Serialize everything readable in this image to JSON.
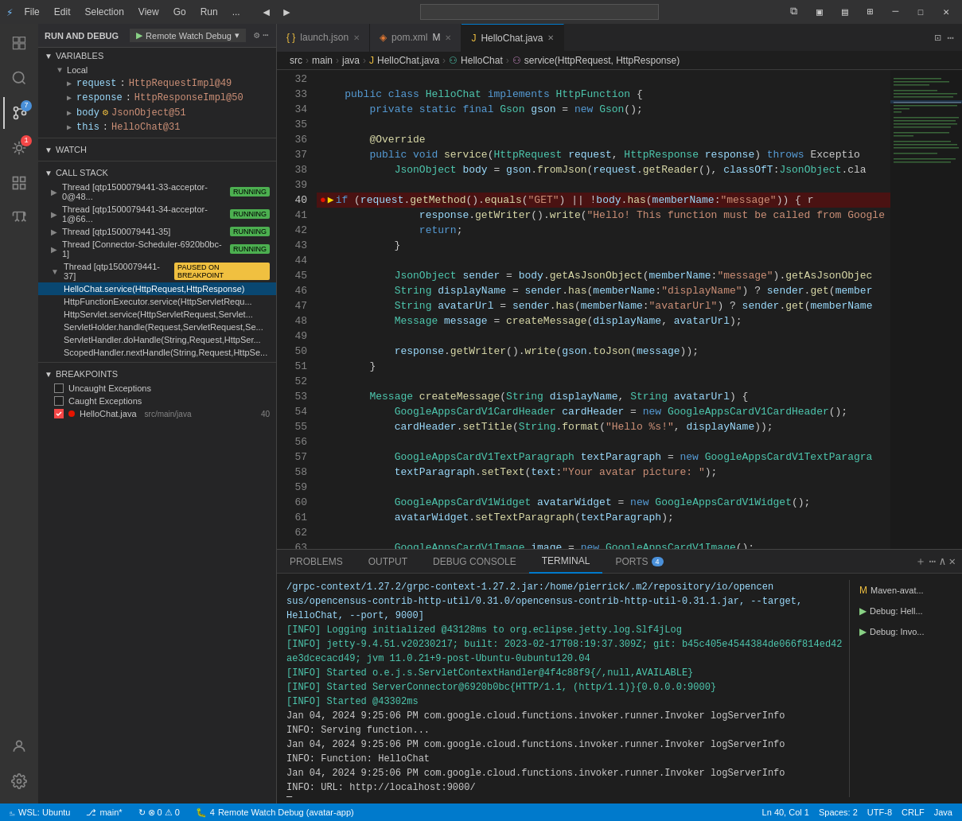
{
  "titlebar": {
    "icon": "⚡",
    "menus": [
      "File",
      "Edit",
      "Selection",
      "View",
      "Go",
      "Run",
      "..."
    ],
    "nav_back": "◄",
    "nav_forward": "►",
    "controls": {
      "minimize": "─",
      "restore": "☐",
      "close": "✕"
    }
  },
  "debug_toolbar": {
    "title": "RUN AND DEBUG",
    "config_label": "Remote Watch Debug",
    "play_icon": "▶",
    "actions": [
      "▶",
      "↺",
      "⟳",
      "⬇",
      "⬆",
      "↩",
      "⏹",
      "🔴",
      "⚡"
    ]
  },
  "tabs": [
    {
      "id": "launch_json",
      "label": "launch.json",
      "icon": "{ }",
      "active": false,
      "modified": false
    },
    {
      "id": "pom_xml",
      "label": "pom.xml",
      "icon": "◈",
      "active": false,
      "modified": true
    },
    {
      "id": "hello_chat",
      "label": "HelloChat.java",
      "icon": "J",
      "active": true,
      "modified": false
    }
  ],
  "breadcrumb": {
    "parts": [
      "src",
      "main",
      "java",
      "HelloChat.java",
      "HelloChat",
      "service(HttpRequest, HttpResponse)"
    ],
    "separators": [
      ">",
      ">",
      ">",
      ">",
      ">"
    ]
  },
  "variables": {
    "section_title": "VARIABLES",
    "subsections": [
      {
        "title": "Local",
        "items": [
          {
            "name": "request",
            "value": "HttpRequestImpl@49",
            "expanded": false
          },
          {
            "name": "response",
            "value": "HttpResponseImpl@50",
            "expanded": false
          },
          {
            "name": "body",
            "type_icon": "⚙",
            "value": "JsonObject@51",
            "expanded": false
          },
          {
            "name": "this",
            "value": "HelloChat@31",
            "expanded": false
          }
        ]
      }
    ]
  },
  "watch": {
    "section_title": "WATCH"
  },
  "call_stack": {
    "section_title": "CALL STACK",
    "threads": [
      {
        "name": "Thread [qtp1500079441-33-acceptor-0@48...",
        "status": "RUNNING"
      },
      {
        "name": "Thread [qtp1500079441-34-acceptor-1@66...",
        "status": "RUNNING"
      },
      {
        "name": "Thread [qtp1500079441-35]",
        "status": "RUNNING"
      },
      {
        "name": "Thread [Connector-Scheduler-6920b0bc-1]",
        "status": "RUNNING"
      },
      {
        "name": "Thread [qtp1500079441-37]",
        "status": "PAUSED ON BREAKPOINT",
        "frames": [
          {
            "name": "HelloChat.service(HttpRequest,HttpResponse)",
            "active": true
          },
          {
            "name": "HttpFunctionExecutor.service(HttpServletRequ...",
            "active": false
          },
          {
            "name": "HttpServlet.service(HttpServletRequest,Servlet...",
            "active": false
          },
          {
            "name": "ServletHolder.handle(Request,ServletRequest,Se...",
            "active": false
          },
          {
            "name": "ServletHandler.doHandle(String,Request,HttpSer...",
            "active": false
          },
          {
            "name": "ScopedHandler.nextHandle(String,Request,HttpSe...",
            "active": false
          }
        ]
      }
    ]
  },
  "breakpoints": {
    "section_title": "BREAKPOINTS",
    "items": [
      {
        "label": "Uncaught Exceptions",
        "checked": false,
        "dot": false
      },
      {
        "label": "Caught Exceptions",
        "checked": false,
        "dot": false
      },
      {
        "label": "HelloChat.java",
        "location": "src/main/java",
        "checked": true,
        "dot": true,
        "line": "40"
      }
    ]
  },
  "code": {
    "filename": "HelloChat.java",
    "lines": [
      {
        "num": 32,
        "content": ""
      },
      {
        "num": 33,
        "content": "    public class HelloChat implements HttpFunction {"
      },
      {
        "num": 34,
        "content": "        private static final Gson gson = new Gson();"
      },
      {
        "num": 35,
        "content": ""
      },
      {
        "num": 36,
        "content": "        @Override"
      },
      {
        "num": 37,
        "content": "        public void service(HttpRequest request, HttpResponse response) throws Exceptio"
      },
      {
        "num": 38,
        "content": "            JsonObject body = gson.fromJson(request.getReader(), classOfT:JsonObject.cla"
      },
      {
        "num": 39,
        "content": ""
      },
      {
        "num": 40,
        "content": "            if (request.getMethod().equals(\"GET\") || !body.has(memberName:\"message\")) { r",
        "breakpoint": true,
        "current": true
      },
      {
        "num": 41,
        "content": "                response.getWriter().write(\"Hello! This function must be called from Google"
      },
      {
        "num": 42,
        "content": "                return;"
      },
      {
        "num": 43,
        "content": "            }"
      },
      {
        "num": 44,
        "content": ""
      },
      {
        "num": 45,
        "content": "            JsonObject sender = body.getAsJsonObject(memberName:\"message\").getAsJsonObjec"
      },
      {
        "num": 46,
        "content": "            String displayName = sender.has(memberName:\"displayName\") ? sender.get(member"
      },
      {
        "num": 47,
        "content": "            String avatarUrl = sender.has(memberName:\"avatarUrl\") ? sender.get(memberName"
      },
      {
        "num": 48,
        "content": "            Message message = createMessage(displayName, avatarUrl);"
      },
      {
        "num": 49,
        "content": ""
      },
      {
        "num": 50,
        "content": "            response.getWriter().write(gson.toJson(message));"
      },
      {
        "num": 51,
        "content": "        }"
      },
      {
        "num": 52,
        "content": ""
      },
      {
        "num": 53,
        "content": "        Message createMessage(String displayName, String avatarUrl) {"
      },
      {
        "num": 54,
        "content": "            GoogleAppsCardV1CardHeader cardHeader = new GoogleAppsCardV1CardHeader();"
      },
      {
        "num": 55,
        "content": "            cardHeader.setTitle(String.format(\"Hello %s!\", displayName));"
      },
      {
        "num": 56,
        "content": ""
      },
      {
        "num": 57,
        "content": "            GoogleAppsCardV1TextParagraph textParagraph = new GoogleAppsCardV1TextParagra"
      },
      {
        "num": 58,
        "content": "            textParagraph.setText(text:\"Your avatar picture: \");"
      },
      {
        "num": 59,
        "content": ""
      },
      {
        "num": 60,
        "content": "            GoogleAppsCardV1Widget avatarWidget = new GoogleAppsCardV1Widget();"
      },
      {
        "num": 61,
        "content": "            avatarWidget.setTextParagraph(textParagraph);"
      },
      {
        "num": 62,
        "content": ""
      },
      {
        "num": 63,
        "content": "            GoogleAppsCardV1Image image = new GoogleAppsCardV1Image();"
      }
    ]
  },
  "panel": {
    "tabs": [
      "PROBLEMS",
      "OUTPUT",
      "DEBUG CONSOLE",
      "TERMINAL",
      "PORTS"
    ],
    "ports_badge": "4",
    "active_tab": "TERMINAL",
    "terminal_lines": [
      "/grpc-context/1.27.2/grpc-context-1.27.2.jar:/home/pierrick/.m2/repository/io/opencensus/opencensus-contrib-http-util/0.31.0/opencensus-contrib-http-util-0.31.1.jar, --target, HelloChat, --port, 9000]",
      "[INFO] Logging initialized @43128ms to org.eclipse.jetty.log.Slf4jLog",
      "[INFO] jetty-9.4.51.v20230217; built: 2023-02-17T08:19:37.309Z; git: b45c405e4544384de066f814ed42ae3dcecacd49; jvm 11.0.21+9-post-Ubuntu-0ubuntu120.04",
      "[INFO] Started o.e.j.s.ServletContextHandler@4f4c88f9{/,null,AVAILABLE}",
      "[INFO] Started ServerConnector@6920b0bc{HTTP/1.1, (http/1.1)}{0.0.0.0:9000}",
      "[INFO] Started @43302ms",
      "Jan 04, 2024 9:25:06 PM com.google.cloud.functions.invoker.runner.Invoker logServerInfo",
      "INFO: Serving function...",
      "Jan 04, 2024 9:25:06 PM com.google.cloud.functions.invoker.runner.Invoker logServerInfo",
      "INFO: Function: HelloChat",
      "Jan 04, 2024 9:25:06 PM com.google.cloud.functions.invoker.runner.Invoker logServerInfo",
      "INFO: URL: http://localhost:9000/"
    ],
    "terminal_sidebar": [
      {
        "label": "Maven-avat...",
        "icon": "M"
      },
      {
        "label": "Debug: Hell...",
        "icon": "▶"
      },
      {
        "label": "Debug: Invo...",
        "icon": "▶"
      }
    ]
  },
  "statusbar": {
    "remote_icon": "⎁",
    "remote_label": "WSL: Ubuntu",
    "branch_icon": "⎇",
    "branch_label": "main*",
    "sync_icon": "↻",
    "errors": "0",
    "warnings": "0",
    "debug_icon": "🐛",
    "threads": "4",
    "debug_label": "Remote Watch Debug (avatar-app)",
    "right": {
      "position": "Ln 40, Col 1",
      "spaces": "Spaces: 2",
      "encoding": "UTF-8",
      "line_ending": "CRLF",
      "language": "Java"
    }
  }
}
